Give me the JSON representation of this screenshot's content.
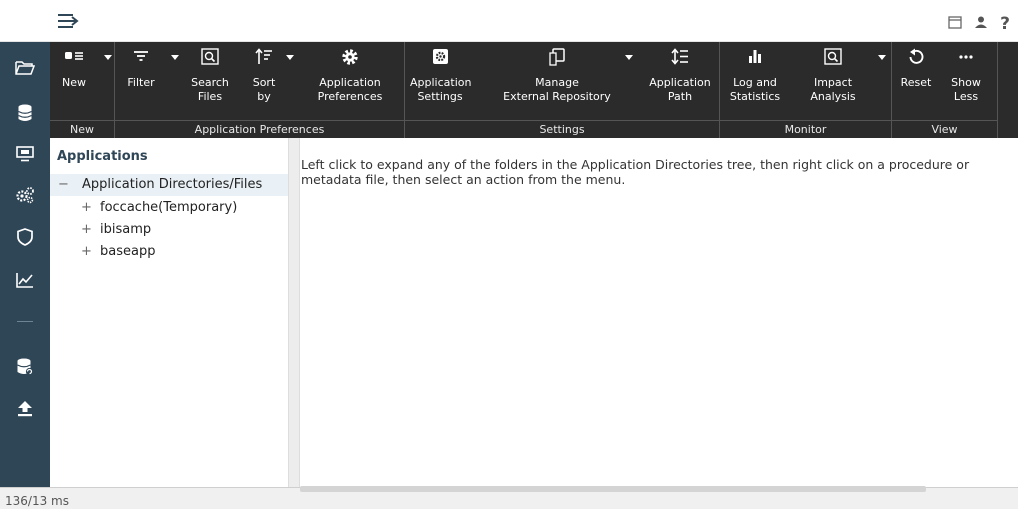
{
  "topbar": {
    "menu_icon": "hamburger-arrow-icon",
    "right_icons": [
      "window-icon",
      "user-icon",
      "help-icon"
    ],
    "help_glyph": "?"
  },
  "rail": {
    "items": [
      "folder-icon",
      "database-icon",
      "monitor-icon",
      "gears-icon",
      "shield-icon",
      "chart-line-icon",
      "database-sync-icon",
      "upload-icon"
    ]
  },
  "ribbon": {
    "groups": {
      "new": "New",
      "app_prefs": "Application Preferences",
      "settings": "Settings",
      "monitor": "Monitor",
      "view": "View"
    },
    "buttons": {
      "new": "New",
      "filter": "Filter",
      "search_files": "Search\nFiles",
      "sort_by": "Sort\nby",
      "app_preferences": "Application\nPreferences",
      "app_settings": "Application\nSettings",
      "manage_repo": "Manage\nExternal Repository",
      "app_path": "Application\nPath",
      "log_stats": "Log and\nStatistics",
      "impact": "Impact\nAnalysis",
      "reset": "Reset",
      "show_less": "Show\nLess"
    }
  },
  "tree": {
    "title": "Applications",
    "root": "Application Directories/Files",
    "root_marker": "−",
    "child_marker": "+",
    "children": [
      "foccache(Temporary)",
      "ibisamp",
      "baseapp"
    ]
  },
  "main": {
    "help_text": "Left click to expand any of the folders in the Application Directories tree, then right click on a procedure or metadata file, then select an action from the menu."
  },
  "status": {
    "time": "136/13 ms"
  },
  "colors": {
    "ribbon_bg": "#2b2b2b",
    "rail_bg": "#2f4657",
    "accent": "#2f4657"
  }
}
